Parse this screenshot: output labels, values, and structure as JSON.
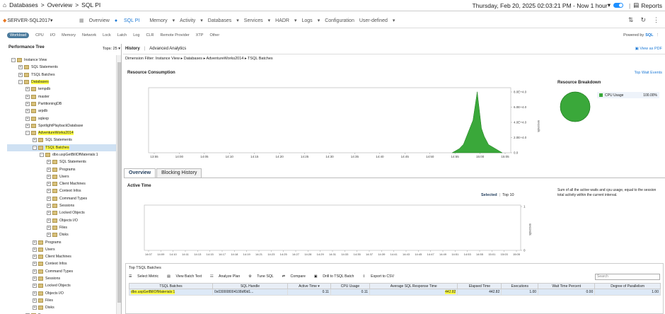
{
  "topbar": {
    "crumbs": [
      "Databases",
      "Overview",
      "SQL PI"
    ],
    "datetime": "Thursday, Feb 20, 2025 02:03:21 PM - Now 1 hour",
    "reports": "Reports"
  },
  "nav": {
    "server": "SERVER-SQL2017",
    "menus": [
      "Overview",
      "SQL PI",
      "Memory",
      "Activity",
      "Databases",
      "Services",
      "HADR",
      "Logs",
      "Configuration",
      "User-defined"
    ]
  },
  "workload_tabs": [
    "Workload",
    "CPU",
    "I/O",
    "Memory",
    "Network",
    "Lock",
    "Latch",
    "Log",
    "CLR",
    "Remote Provider",
    "XTP",
    "Other"
  ],
  "powered_by": "Powered by",
  "tree": {
    "title": "Performance Tree",
    "tops": "Tops: 25",
    "nodes": [
      {
        "label": "Instance View",
        "indent": 0,
        "exp": "-"
      },
      {
        "label": "SQL Statements",
        "indent": 1,
        "exp": "+"
      },
      {
        "label": "TSQL Batches",
        "indent": 1,
        "exp": "+"
      },
      {
        "label": "Databases",
        "indent": 1,
        "exp": "-",
        "hl": true
      },
      {
        "label": "tempdb",
        "indent": 2,
        "exp": "+"
      },
      {
        "label": "master",
        "indent": 2,
        "exp": "+"
      },
      {
        "label": "PartitioningDB",
        "indent": 2,
        "exp": "+"
      },
      {
        "label": "arpdb",
        "indent": 2,
        "exp": "+"
      },
      {
        "label": "sqlexp",
        "indent": 2,
        "exp": "+"
      },
      {
        "label": "SpotlightPlaybackDatabase",
        "indent": 2,
        "exp": "+"
      },
      {
        "label": "AdventureWorks2014",
        "indent": 2,
        "exp": "-",
        "hl": true
      },
      {
        "label": "SQL Statements",
        "indent": 3,
        "exp": "+"
      },
      {
        "label": "TSQL Batches",
        "indent": 3,
        "exp": "-",
        "hl": true,
        "sel": true
      },
      {
        "label": "dbo.uspGetBillOfMaterials:1",
        "indent": 4,
        "exp": "-"
      },
      {
        "label": "SQL Statements",
        "indent": 5,
        "exp": "+"
      },
      {
        "label": "Programs",
        "indent": 5,
        "exp": "+"
      },
      {
        "label": "Users",
        "indent": 5,
        "exp": "+"
      },
      {
        "label": "Client Machines",
        "indent": 5,
        "exp": "+"
      },
      {
        "label": "Context Infos",
        "indent": 5,
        "exp": "+"
      },
      {
        "label": "Command Types",
        "indent": 5,
        "exp": "+"
      },
      {
        "label": "Sessions",
        "indent": 5,
        "exp": "+"
      },
      {
        "label": "Locked Objects",
        "indent": 5,
        "exp": "+"
      },
      {
        "label": "Objects I/O",
        "indent": 5,
        "exp": "+"
      },
      {
        "label": "Files",
        "indent": 5,
        "exp": "+"
      },
      {
        "label": "Disks",
        "indent": 5,
        "exp": "+"
      },
      {
        "label": "Programs",
        "indent": 3,
        "exp": "+"
      },
      {
        "label": "Users",
        "indent": 3,
        "exp": "+"
      },
      {
        "label": "Client Machines",
        "indent": 3,
        "exp": "+"
      },
      {
        "label": "Context Infos",
        "indent": 3,
        "exp": "+"
      },
      {
        "label": "Command Types",
        "indent": 3,
        "exp": "+"
      },
      {
        "label": "Sessions",
        "indent": 3,
        "exp": "+"
      },
      {
        "label": "Locked Objects",
        "indent": 3,
        "exp": "+"
      },
      {
        "label": "Objects I/O",
        "indent": 3,
        "exp": "+"
      },
      {
        "label": "Files",
        "indent": 3,
        "exp": "+"
      },
      {
        "label": "Disks",
        "indent": 3,
        "exp": "+"
      },
      {
        "label": "Programs",
        "indent": 2,
        "exp": "+"
      }
    ]
  },
  "main": {
    "tabs": [
      "History",
      "Advanced Analytics"
    ],
    "view_pdf": "View as PDF",
    "filter": "Dimension Filter: Instance View ▸ Databases ▸ AdventureWorks2014 ▸ TSQL Batches",
    "resource_title": "Resource Consumption",
    "top_wait": "Top Wait Events",
    "rc_ticks_x": [
      "13:55",
      "14:00",
      "14:05",
      "14:10",
      "14:15",
      "14:20",
      "14:25",
      "14:30",
      "14:35",
      "14:40",
      "14:45",
      "14:50",
      "14:55",
      "15:00",
      "15:05"
    ],
    "rc_ticks_y": [
      "8.0E+4.0",
      "6.0E+4.0",
      "4.0E+4.0",
      "2.0E+4.0",
      "0.0"
    ],
    "rc_unit": "seconds",
    "breakdown_title": "Resource Breakdown",
    "breakdown_legend": "CPU Usage",
    "breakdown_pct": "100.00%",
    "overview_tabs": [
      "Overview",
      "Blocking History"
    ],
    "active_time": "Active Time",
    "selected": "Selected",
    "top10": "Top 10",
    "at_desc": "Sum of all the active waits and cpu usage, equal to the session total activity within the current interval.",
    "at_ticks_x": [
      "14:07",
      "14:09",
      "14:10",
      "14:11",
      "14:13",
      "14:15",
      "14:17",
      "14:18",
      "14:19",
      "14:21",
      "14:23",
      "14:25",
      "14:27",
      "14:28",
      "14:29",
      "14:31",
      "14:33",
      "14:35",
      "14:37",
      "14:39",
      "14:41",
      "14:43",
      "14:45",
      "14:47",
      "14:49",
      "14:51",
      "14:53",
      "14:55",
      "15:01",
      "15:03",
      "15:05"
    ],
    "at_ticks_y": [
      "1",
      "0"
    ],
    "at_unit": "seconds"
  },
  "tsql": {
    "title": "Top TSQL Batches",
    "toolbar": [
      "Select Metric",
      "View Batch Text",
      "Analyze Plan",
      "Tune SQL",
      "Compare",
      "Drill to TSQL Batch",
      "Export to CSV"
    ],
    "search_placeholder": "Search",
    "columns": [
      "TSQL Batches",
      "SQL Handle",
      "Active Time",
      "CPU Usage",
      "Average SQL Response Time",
      "Elapsed Time",
      "Executions",
      "Wait Time Percent",
      "Degree of Parallelism"
    ],
    "rows": [
      [
        "dbo.uspGetBillOfMaterials:1",
        "0x030008004108df0d1...",
        "0.11",
        "0.11",
        "442.82",
        "442.82",
        "1.00",
        "0.00",
        "1.00"
      ]
    ]
  },
  "chart_data": [
    {
      "type": "area",
      "title": "Resource Consumption",
      "x": [
        "13:55",
        "14:00",
        "14:05",
        "14:10",
        "14:15",
        "14:20",
        "14:25",
        "14:30",
        "14:35",
        "14:40",
        "14:45",
        "14:50",
        "14:55",
        "15:00",
        "15:05"
      ],
      "series": [
        {
          "name": "CPU Usage",
          "values": [
            0,
            0,
            0,
            0,
            0,
            0,
            0,
            0,
            0,
            0,
            0,
            0,
            5000,
            75000,
            0
          ]
        }
      ],
      "ylim": [
        0,
        80000
      ],
      "ylabel": "seconds"
    },
    {
      "type": "pie",
      "title": "Resource Breakdown",
      "categories": [
        "CPU Usage"
      ],
      "values": [
        100
      ]
    }
  ]
}
